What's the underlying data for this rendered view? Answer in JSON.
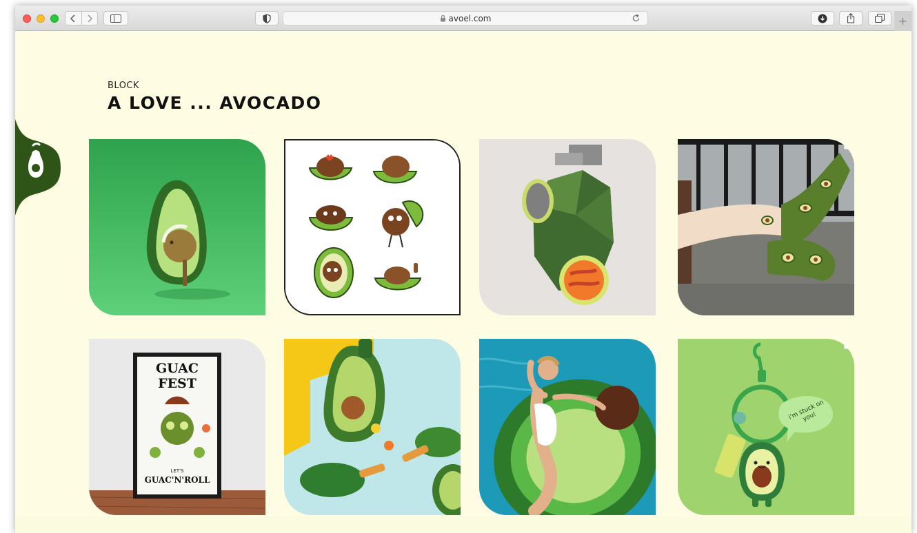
{
  "browser": {
    "url": "avoel.com"
  },
  "page": {
    "eyebrow": "BLOCK",
    "title": "A LOVE ... AVOCADO",
    "colors": {
      "background": "#fefde3",
      "brand_green": "#2f5417"
    }
  },
  "gallery": {
    "items": [
      {
        "name": "avocado-character-3d"
      },
      {
        "name": "avocado-sticker-sheet"
      },
      {
        "name": "avocado-grenade-case"
      },
      {
        "name": "avocado-socks"
      },
      {
        "name": "guac-fest-poster"
      },
      {
        "name": "avocado-ping-pong-set"
      },
      {
        "name": "avocado-pool-float"
      },
      {
        "name": "avocado-keychain"
      }
    ],
    "poster_text": [
      "GUAC FEST",
      "LET'S",
      "GUAC'N'ROLL"
    ],
    "keychain_bubble": "i'm stuck on you!"
  }
}
